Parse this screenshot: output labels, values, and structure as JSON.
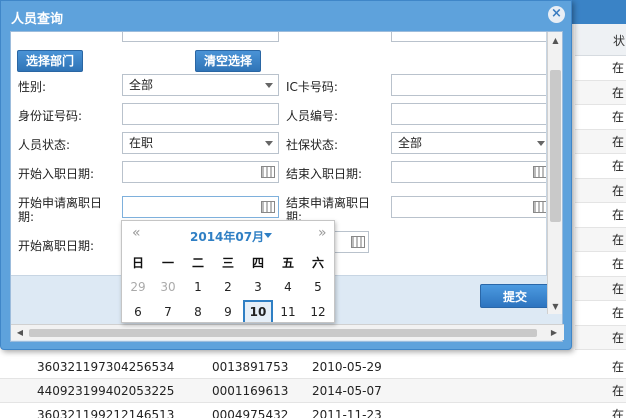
{
  "background": {
    "column_header": "状",
    "right_cells": [
      "在",
      "在",
      "在",
      "在",
      "在",
      "在",
      "在",
      "在",
      "在",
      "在",
      "在",
      "在"
    ],
    "rows": [
      {
        "id": "360321197304256534",
        "code": "0013891753",
        "date": "2010-05-29",
        "status": "在"
      },
      {
        "id": "440923199402053225",
        "code": "0001169613",
        "date": "2014-05-07",
        "status": "在"
      },
      {
        "id": "360321199212146513",
        "code": "0004975432",
        "date": "2011-11-23",
        "status": "在"
      }
    ]
  },
  "dialog": {
    "title": "人员查询",
    "select_dept_label": "选择部门",
    "clear_selection_label": "清空选择",
    "submit_label": "提交",
    "fields": {
      "gender": {
        "label": "性别:",
        "value": "全部"
      },
      "ic_card": {
        "label": "IC卡号码:",
        "value": ""
      },
      "id_card": {
        "label": "身份证号码:",
        "value": ""
      },
      "staff_no": {
        "label": "人员编号:",
        "value": ""
      },
      "staff_status": {
        "label": "人员状态:",
        "value": "在职"
      },
      "social_security": {
        "label": "社保状态:",
        "value": "全部"
      },
      "hire_start": {
        "label": "开始入职日期:",
        "value": ""
      },
      "hire_end": {
        "label": "结束入职日期:",
        "value": ""
      },
      "apply_leave_start_1": {
        "label": "开始申请离职日",
        "label2": "期:"
      },
      "apply_leave_end_1": {
        "label": "结束申请离职日",
        "label2": "期:"
      },
      "leave_start": {
        "label": "开始离职日期:"
      }
    }
  },
  "calendar": {
    "prev": "«",
    "next": "»",
    "month_label": "2014年07月",
    "weekdays": [
      "日",
      "一",
      "二",
      "三",
      "四",
      "五",
      "六"
    ],
    "week1": [
      "29",
      "30",
      "1",
      "2",
      "3",
      "4",
      "5"
    ],
    "week2": [
      "6",
      "7",
      "8",
      "9",
      "10",
      "11",
      "12"
    ],
    "today": "10"
  }
}
